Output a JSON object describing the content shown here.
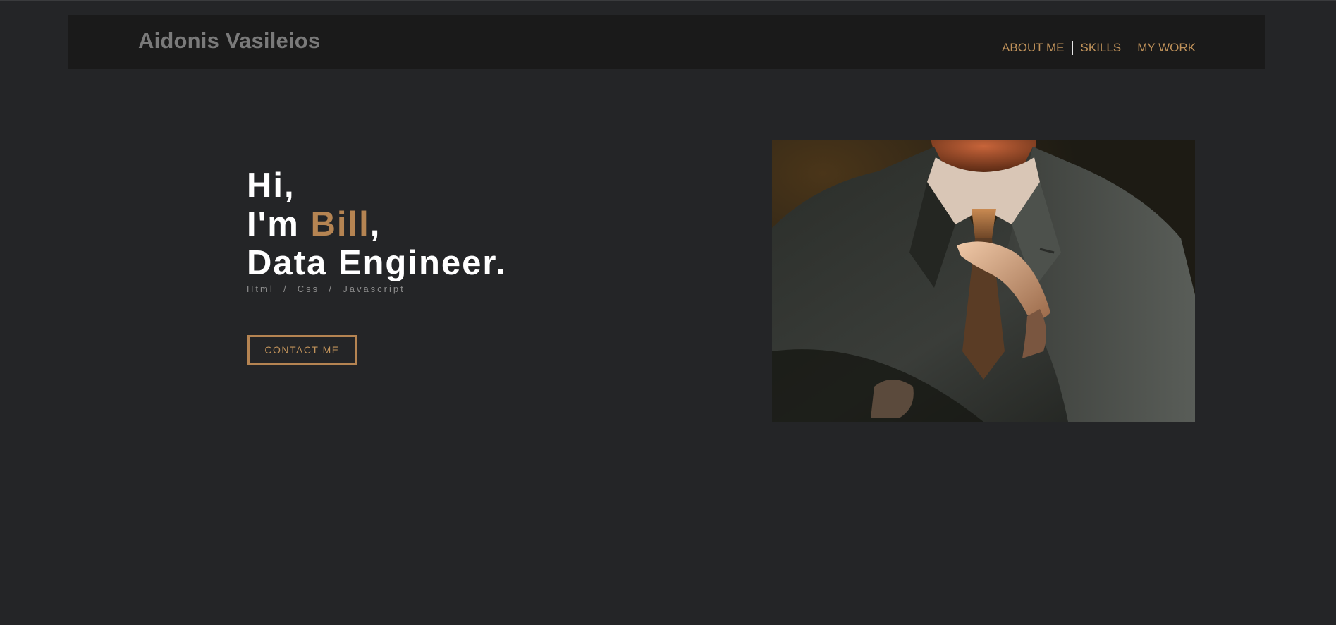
{
  "header": {
    "brand": "Aidonis Vasileios",
    "nav": [
      {
        "label": "ABOUT ME"
      },
      {
        "label": "SKILLS"
      },
      {
        "label": "MY WORK"
      }
    ]
  },
  "hero": {
    "greeting": "Hi,",
    "intro_prefix": "I'm ",
    "name": "Bill",
    "intro_suffix": ",",
    "role": "Data Engineer.",
    "skills": "Html  /  Css  /  Javascript",
    "cta_label": "CONTACT ME"
  },
  "image": {
    "alt": "Man in a grey suit adjusting his tie"
  },
  "colors": {
    "background": "#242527",
    "navbar": "#1a1a1a",
    "accent": "#b58452",
    "brand_text": "#7a7a7a"
  }
}
